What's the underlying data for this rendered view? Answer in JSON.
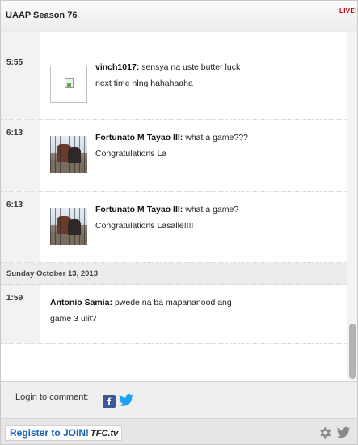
{
  "header": {
    "title": "UAAP Season 76",
    "live_label": "LIVE!"
  },
  "feed": {
    "entries": [
      {
        "time": "",
        "user": "",
        "text": ""
      },
      {
        "time": "5:55",
        "user": "vinch1017:",
        "text": "sensya na uste butter luck next time nlng hahahaaha",
        "avatar": "broken-image"
      },
      {
        "time": "6:13",
        "user": "Fortunato M Tayao III:",
        "text": "what a game??? Congratulations La",
        "avatar": "photo"
      },
      {
        "time": "6:13",
        "user": "Fortunato M Tayao III:",
        "text": "what a game? Congratulations Lasalle!!!!",
        "avatar": "photo"
      }
    ],
    "date_separator": "Sunday October 13, 2013",
    "entries_after": [
      {
        "time": "1:59",
        "user": "Antonio Samia:",
        "text": "pwede na ba mapananood ang game 3 ulit?"
      }
    ]
  },
  "footer": {
    "login_text": "Login to comment:",
    "facebook_glyph": "f",
    "register_label": "Register to JOIN!",
    "brand_label": "TFC.tv"
  },
  "colors": {
    "live": "#c20000",
    "register": "#1a63b8",
    "facebook": "#3b5998",
    "twitter": "#1da1f2"
  }
}
